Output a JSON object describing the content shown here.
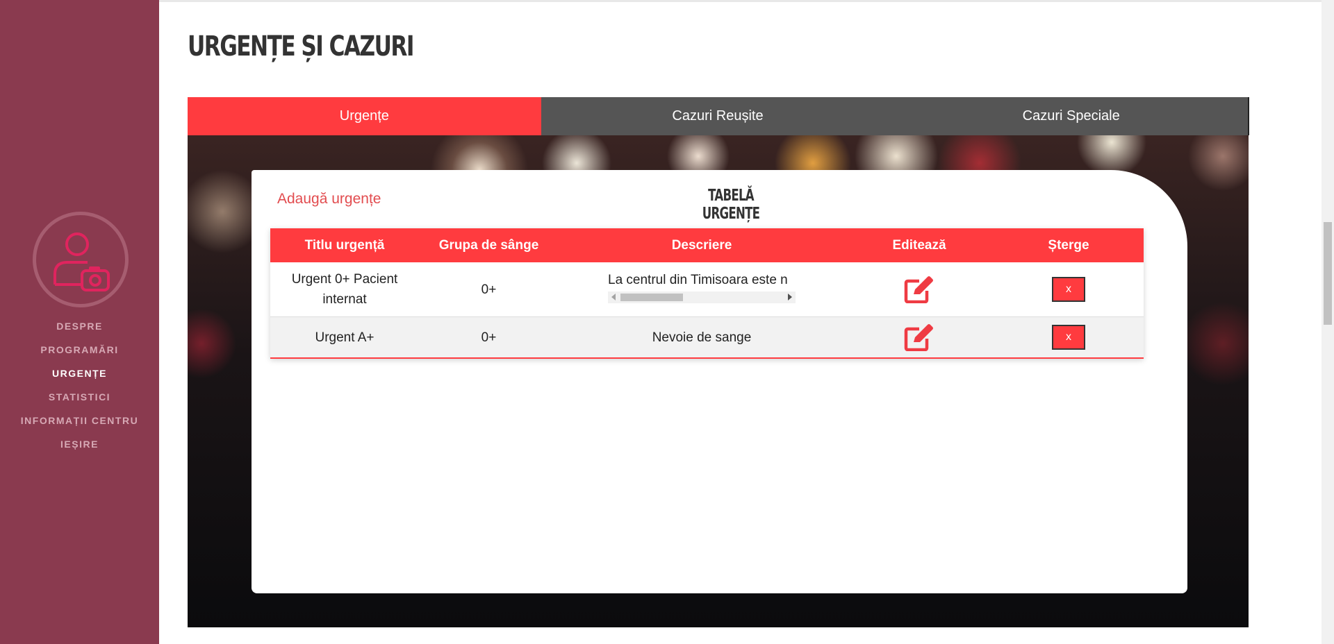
{
  "sidebar": {
    "nav": [
      "DESPRE",
      "PROGRAMĂRI",
      "URGENȚE",
      "STATISTICI",
      "INFORMAȚII CENTRU",
      "IEȘIRE"
    ],
    "active_item": "URGENȚE",
    "avatar_icon": "user-camera-icon",
    "background_color": "#8a3a4f"
  },
  "page": {
    "title": "URGENȚE ȘI CAZURI"
  },
  "tabs": [
    {
      "label": "Urgențe",
      "active": true
    },
    {
      "label": "Cazuri Reușite",
      "active": false
    },
    {
      "label": "Cazuri Speciale",
      "active": false
    }
  ],
  "card": {
    "add_link": "Adaugă urgențe",
    "table_title": "TABELĂ URGENȚE"
  },
  "table": {
    "columns": [
      "Titlu urgență",
      "Grupa de sânge",
      "Descriere",
      "Editează",
      "Șterge"
    ],
    "rows": [
      {
        "title": "Urgent 0+ Pacient internat",
        "blood_group": "0+",
        "description": "La centrul din Timisoara este n",
        "delete_label": "x"
      },
      {
        "title": "Urgent A+",
        "blood_group": "0+",
        "description": "Nevoie de sange",
        "delete_label": "x"
      }
    ]
  },
  "colors": {
    "accent": "#ff3b3f",
    "tab_inactive": "#555555",
    "title_text": "#333333"
  },
  "icons": {
    "edit": "edit-pencil-icon",
    "delete": "x"
  }
}
